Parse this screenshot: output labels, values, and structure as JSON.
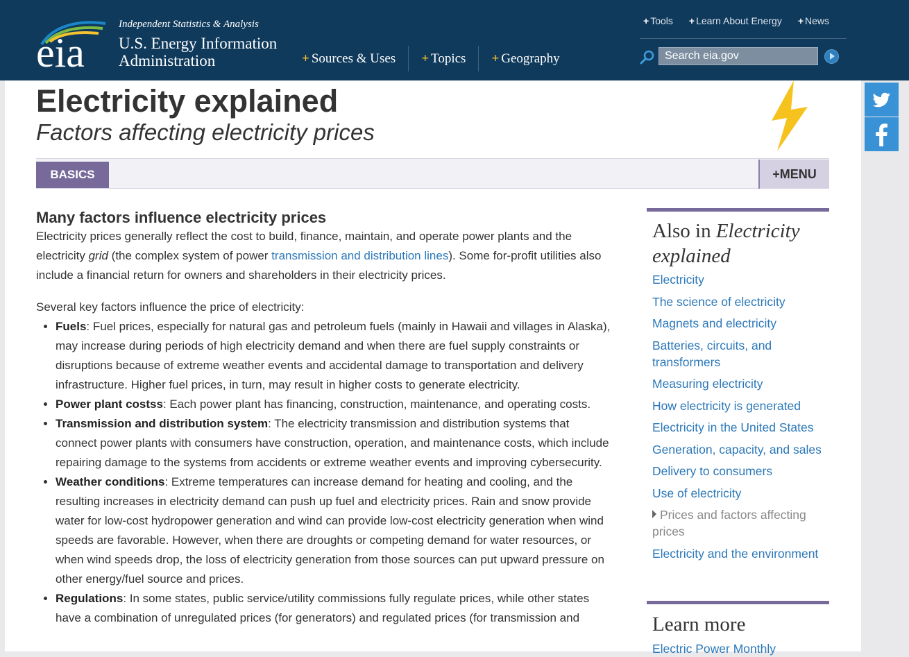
{
  "header": {
    "logo_text": "eia",
    "tagline": "Independent Statistics & Analysis",
    "brand_line1": "U.S. Energy Information",
    "brand_line2": "Administration",
    "main_nav": [
      {
        "label": "Sources & Uses"
      },
      {
        "label": "Topics"
      },
      {
        "label": "Geography"
      }
    ],
    "top_links": [
      {
        "label": "Tools"
      },
      {
        "label": "Learn About Energy"
      },
      {
        "label": "News"
      }
    ],
    "search_placeholder": "Search eia.gov"
  },
  "page": {
    "title": "Electricity explained",
    "subtitle": "Factors affecting electricity prices"
  },
  "tabs": {
    "basics_label": "BASICS",
    "menu_label": "+MENU"
  },
  "social": [
    "twitter-icon",
    "facebook-icon"
  ],
  "content": {
    "heading": "Many factors influence electricity prices",
    "intro": {
      "before_em": "Electricity prices generally reflect the cost to build, finance, maintain, and operate power plants and the electricity ",
      "em": "grid",
      "middle": " (the complex system of power ",
      "link": "transmission and distribution lines",
      "after": "). Some for-profit utilities also include a financial return for owners and shareholders in their electricity prices."
    },
    "factors_intro": "Several key factors influence the price of electricity:",
    "factors": [
      {
        "term": "Fuels",
        "text": ": Fuel prices, especially for natural gas and petroleum fuels (mainly in Hawaii and villages in Alaska), may increase during periods of high electricity demand and when there are fuel supply constraints or disruptions because of extreme weather events and accidental damage to transportation and delivery infrastructure. Higher fuel prices, in turn, may result in higher costs to generate electricity."
      },
      {
        "term": "Power plant costss",
        "text": ": Each power plant has financing, construction, maintenance, and operating costs."
      },
      {
        "term": "Transmission and distribution system",
        "text": ": The electricity transmission and distribution systems that connect power plants with consumers have construction, operation, and maintenance costs, which include repairing damage to the systems from accidents or extreme weather events and improving cybersecurity."
      },
      {
        "term": "Weather conditions",
        "text": ": Extreme temperatures can increase demand for heating and cooling, and the resulting increases in electricity demand can push up fuel and electricity prices. Rain and snow provide water for low-cost hydropower generation and wind can provide low-cost electricity generation when wind speeds are favorable. However, when there are droughts or competing demand for water resources, or when wind speeds drop, the loss of electricity generation from those sources can put upward pressure on other energy/fuel source and prices."
      },
      {
        "term": "Regulations",
        "text": ": In some states, public service/utility commissions fully regulate prices, while other states have a combination of unregulated prices (for generators) and regulated prices (for transmission and"
      }
    ]
  },
  "sidebar": {
    "title_plain": "Also in ",
    "title_em": "Electricity explained",
    "items": [
      {
        "label": "Electricity"
      },
      {
        "label": "The science of electricity"
      },
      {
        "label": "Magnets and electricity"
      },
      {
        "label": "Batteries, circuits, and transformers"
      },
      {
        "label": "Measuring electricity"
      },
      {
        "label": "How electricity is generated"
      },
      {
        "label": "Electricity in the United States"
      },
      {
        "label": "Generation, capacity, and sales"
      },
      {
        "label": "Delivery to consumers"
      },
      {
        "label": "Use of electricity"
      },
      {
        "label": "Prices and factors affecting prices"
      },
      {
        "label": "Electricity and the environment"
      }
    ],
    "learn_more_title": "Learn more",
    "learn_more_link": "Electric Power Monthly"
  },
  "colors": {
    "header_bg": "#0f3a5c",
    "accent_purple": "#776a9b",
    "link_blue": "#2b78b9",
    "plus_yellow": "#f4c22f",
    "social_blue": "#3992d6"
  }
}
